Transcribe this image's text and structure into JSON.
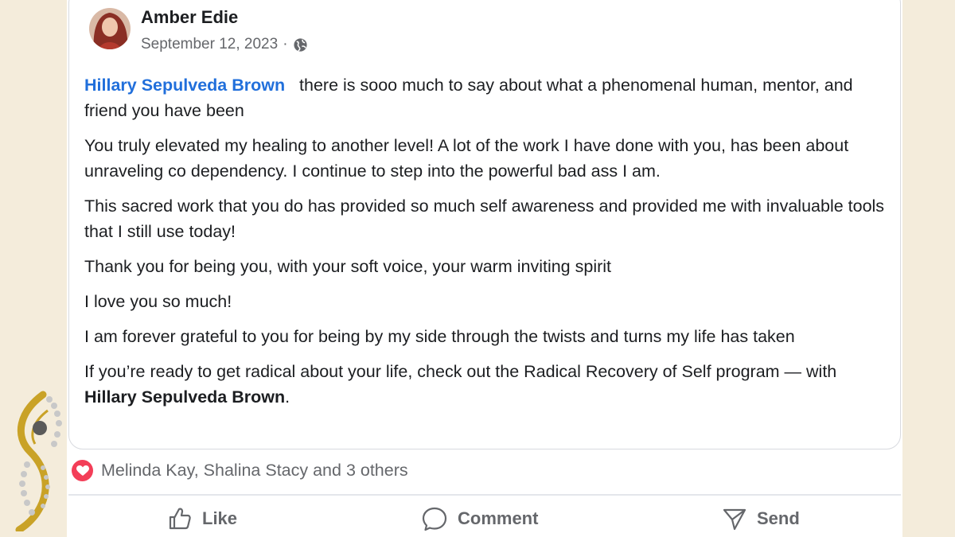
{
  "post": {
    "author": "Amber Edie",
    "date": "September 12, 2023",
    "separator": "·",
    "privacy_icon": "globe-icon",
    "mention_name": "Hillary Sepulveda Brown",
    "intro_text": "there is sooo much to say about what a phenomenal human, mentor, and friend you have been",
    "paragraphs": [
      "You truly elevated my healing to another level! A lot of the work I have done with you, has been about unraveling co dependency. I continue to step into the powerful bad ass I am.",
      "This sacred work that you do has provided so much self awareness and provided me with invaluable tools that I still use today!",
      "Thank you for being you, with your soft voice, your warm inviting spirit",
      "I love you so much!",
      "I am forever grateful to you for being by my side through the twists and turns my life has taken"
    ],
    "closing_text": "If you’re ready to get radical about your life, check out the Radical Recovery of Self program — with ",
    "tagged_name": "Hillary Sepulveda Brown",
    "tagged_suffix": "."
  },
  "reactions": {
    "icon": "heart-icon",
    "summary": "Melinda Kay, Shalina Stacy and 3 others"
  },
  "actions": {
    "like": "Like",
    "comment": "Comment",
    "send": "Send"
  },
  "colors": {
    "mention": "#216fdb",
    "heart": "#f33e58",
    "background": "#f4ecdb",
    "logo_gold": "#c9a227"
  }
}
